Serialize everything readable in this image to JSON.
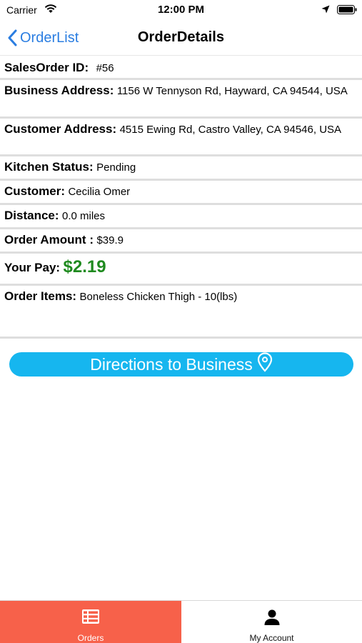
{
  "status_bar": {
    "carrier": "Carrier",
    "time": "12:00 PM"
  },
  "nav": {
    "back_label": "OrderList",
    "title": "OrderDetails"
  },
  "order": {
    "sales_order_id": {
      "label": "SalesOrder ID:",
      "value": "#56"
    },
    "business_address": {
      "label": "Business Address:",
      "value": "1156 W Tennyson Rd, Hayward, CA 94544, USA"
    },
    "customer_address": {
      "label": "Customer Address:",
      "value": "4515 Ewing Rd, Castro Valley, CA 94546, USA"
    },
    "kitchen_status": {
      "label": "Kitchen Status:",
      "value": "Pending"
    },
    "customer": {
      "label": "Customer:",
      "value": "Cecilia Omer"
    },
    "distance": {
      "label": "Distance:",
      "value": "0.0 miles"
    },
    "order_amount": {
      "label": "Order Amount :",
      "value": "$39.9"
    },
    "your_pay": {
      "label": "Your Pay:",
      "value": "$2.19"
    },
    "order_items": {
      "label": "Order Items:",
      "value": "Boneless Chicken Thigh - 10(lbs)"
    }
  },
  "actions": {
    "directions_label": "Directions to Business"
  },
  "tabs": [
    {
      "label": "Orders",
      "icon": "list-icon",
      "selected": true
    },
    {
      "label": "My Account",
      "icon": "person-icon",
      "selected": false
    }
  ],
  "colors": {
    "accent_blue": "#2a7de1",
    "directions_button": "#16b6ef",
    "pay_green": "#1e8a1e",
    "selected_tab": "#f7614a"
  }
}
